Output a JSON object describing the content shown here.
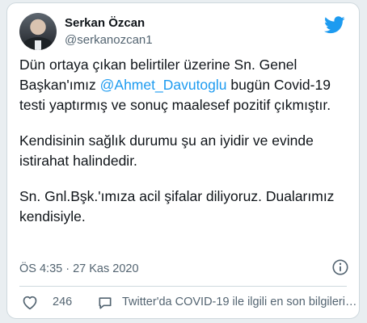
{
  "tweet": {
    "author_name": "Serkan Özcan",
    "author_handle": "@serkanozcan1",
    "paragraph1_before": "Dün ortaya çıkan belirtiler üzerine Sn. Genel Başkan'ımız ",
    "mention": "@Ahmet_Davutoglu",
    "paragraph1_after": " bugün Covid-19 testi yaptırmış ve sonuç maalesef pozitif çıkmıştır.",
    "paragraph2": "Kendisinin sağlık durumu şu an iyidir ve evinde istirahat halindedir.",
    "paragraph3": "Sn. Gnl.Bşk.'ımıza acil şifalar diliyoruz. Dualarımız kendisiyle.",
    "timestamp": "ÖS 4:35 · 27 Kas 2020",
    "like_count": "246",
    "covid_info_text": "Twitter'da COVID-19 ile ilgili en son bilgileri…"
  },
  "colors": {
    "accent": "#1d9bf0",
    "text": "#0f1419",
    "muted": "#536471",
    "like": "#e0245e"
  },
  "icons": {
    "brand": "twitter-bird-icon",
    "info": "info-icon",
    "like": "heart-icon",
    "covid": "speech-bubble-icon"
  }
}
